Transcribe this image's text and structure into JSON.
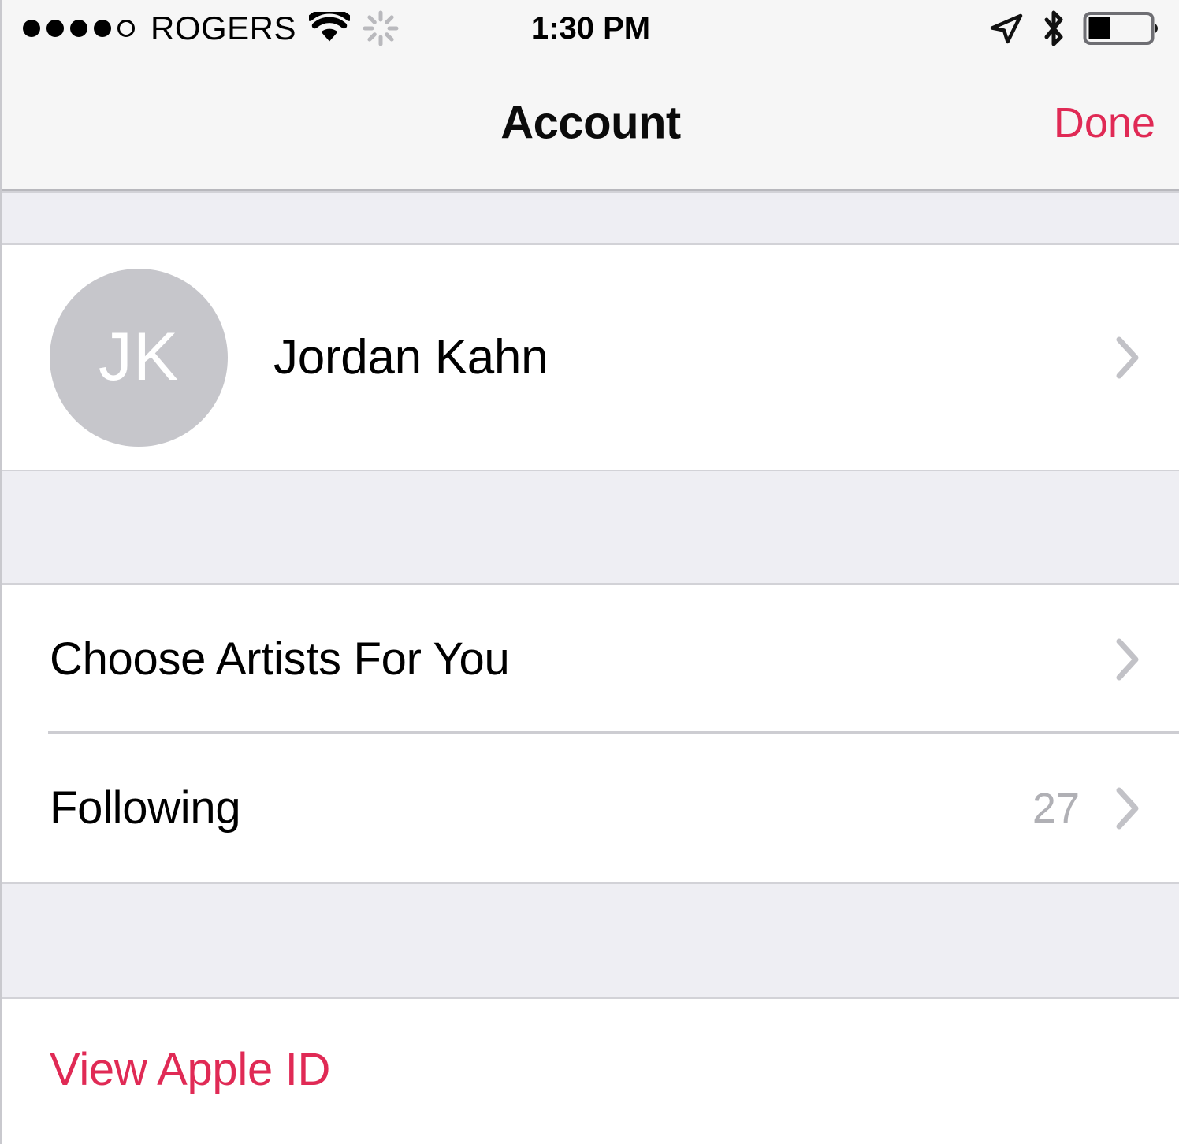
{
  "status_bar": {
    "signal_dots_filled": 4,
    "signal_dots_total": 5,
    "carrier": "ROGERS",
    "wifi_icon": "wifi-icon",
    "activity_icon": "network-activity-spinner-icon",
    "time": "1:30 PM",
    "location_icon": "location-arrow-icon",
    "bluetooth_icon": "bluetooth-icon",
    "battery_icon": "battery-icon",
    "battery_level_percent": 35
  },
  "nav_bar": {
    "title": "Account",
    "done_label": "Done"
  },
  "profile": {
    "initials": "JK",
    "name": "Jordan Kahn",
    "chevron_icon": "chevron-right-icon"
  },
  "settings_group": {
    "rows": [
      {
        "label": "Choose Artists For You",
        "value": "",
        "chevron_icon": "chevron-right-icon"
      },
      {
        "label": "Following",
        "value": "27",
        "chevron_icon": "chevron-right-icon"
      }
    ]
  },
  "account_actions": {
    "view_apple_id_label": "View Apple ID"
  },
  "colors": {
    "accent": "#e02a55",
    "group_background": "#eeeef3",
    "bar_background": "#f6f6f6",
    "cell_background": "#ffffff",
    "separator": "#cdcdd2",
    "avatar_background": "#c6c6cb",
    "secondary_text": "#b0b0b5"
  }
}
